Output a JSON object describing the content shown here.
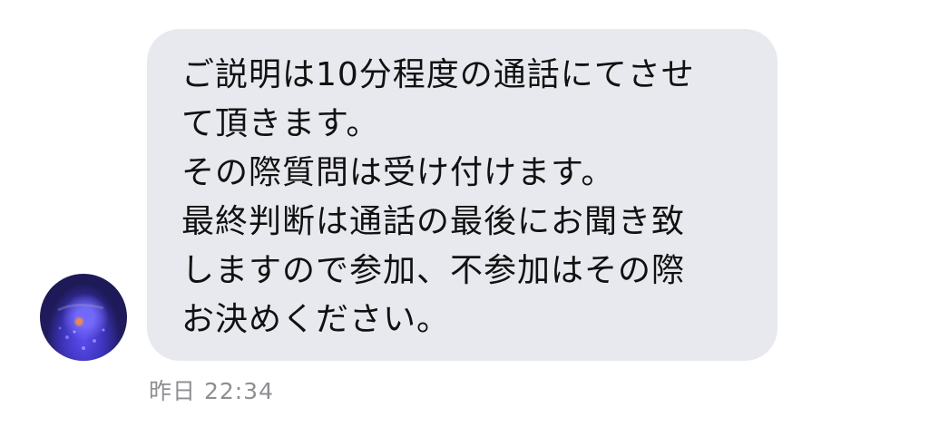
{
  "message": {
    "lines": [
      "ご説明は10分程度の通話にてさせ",
      "て頂きます。",
      "その際質問は受け付けます。",
      "最終判断は通話の最後にお聞き致",
      "しますので参加、不参加はその際",
      "お決めください。"
    ],
    "timestamp": "昨日 22:34"
  },
  "colors": {
    "bubble_background": "#e8e9ee",
    "message_text": "#111111",
    "timestamp_text": "#8e8e93"
  },
  "icons": {
    "avatar": "avatar-photo"
  }
}
